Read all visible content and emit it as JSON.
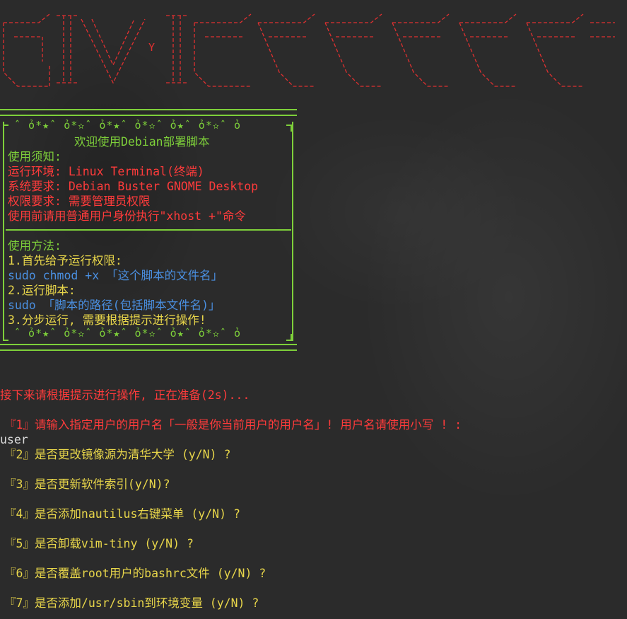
{
  "banner": {
    "letter": "Y",
    "color": "#e03030"
  },
  "info_box": {
    "deco_top": "ˆ ỏ*★ˆ ỏ*✫ˆ ỏ*★ˆ ỏ*✫ˆ ỏ★ˆ ỏ*✫ˆ ỏ",
    "deco_bottom": "ˆ ỏ*★ˆ ỏ*✫ˆ ỏ*★ˆ ỏ*✫ˆ ỏ★ˆ ỏ*✫ˆ ỏ",
    "title": "欢迎使用Debian部署脚本",
    "notice_heading": "使用须知:",
    "env": "运行环境: Linux Terminal(终端)",
    "system": "系统要求: Debian Buster GNOME Desktop",
    "permission": "权限要求: 需要管理员权限",
    "xhost": "使用前请用普通用户身份执行\"xhost +\"命令",
    "usage_heading": "使用方法:",
    "step1": "1.首先给予运行权限:",
    "step1_cmd": "sudo chmod +x 「这个脚本的文件名」",
    "step2": "2.运行脚本:",
    "step2_cmd": "sudo 「脚本的路径(包括脚本文件名)」",
    "step3": "3.分步运行, 需要根据提示进行操作!"
  },
  "log": {
    "prepare": "接下来请根据提示进行操作, 正在准备(2s)...",
    "q1": "『1』请输入指定用户的用户名「一般是你当前用户的用户名」! 用户名请使用小写 ! :",
    "q1_answer": "user",
    "q2": "『2』是否更改镜像源为清华大学 (y/N) ?",
    "q3": "『3』是否更新软件索引(y/N)?",
    "q4": "『4』是否添加nautilus右键菜单 (y/N) ?",
    "q5": "『5』是否卸载vim-tiny (y/N) ?",
    "q6": "『6』是否覆盖root用户的bashrc文件 (y/N) ?",
    "q7": "『7』是否添加/usr/sbin到环境变量 (y/N) ?"
  },
  "colors": {
    "background": "#2b2b2b",
    "green": "#7ed03a",
    "red": "#ff3b3b",
    "yellow": "#e8d64a",
    "blue": "#4a8fe0"
  }
}
